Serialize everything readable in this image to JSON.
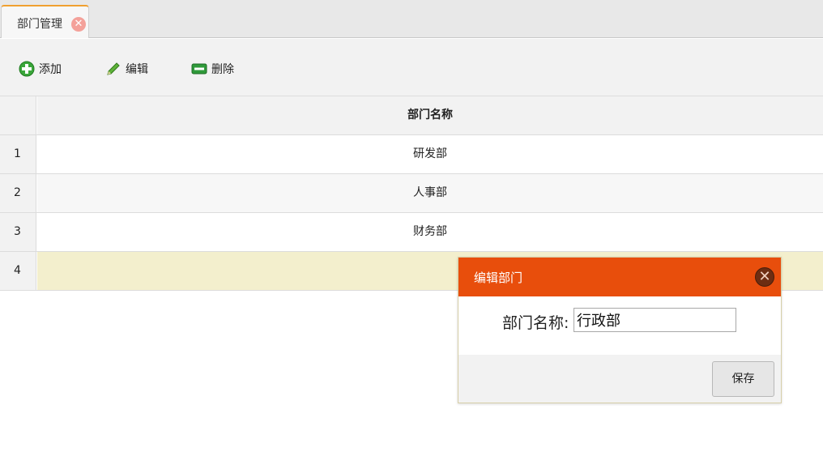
{
  "tabs": [
    {
      "label": "部门管理",
      "close_icon": "close-icon",
      "accent": "#f0a030"
    }
  ],
  "toolbar": {
    "add_label": "添加",
    "edit_label": "编辑",
    "delete_label": "删除",
    "icons": {
      "add": "plus-icon",
      "edit": "pencil-icon",
      "delete": "minus-icon"
    }
  },
  "grid": {
    "columns": [
      "部门名称"
    ],
    "rows": [
      {
        "num": "1",
        "name": "研发部"
      },
      {
        "num": "2",
        "name": "人事部"
      },
      {
        "num": "3",
        "name": "财务部"
      },
      {
        "num": "4",
        "name": ""
      }
    ],
    "selected_row": 4,
    "selected_color": "#f3efcd"
  },
  "dialog": {
    "title": "编辑部门",
    "field_label": "部门名称:",
    "field_value": "行政部",
    "save_label": "保存",
    "header_color": "#e84e0c"
  }
}
